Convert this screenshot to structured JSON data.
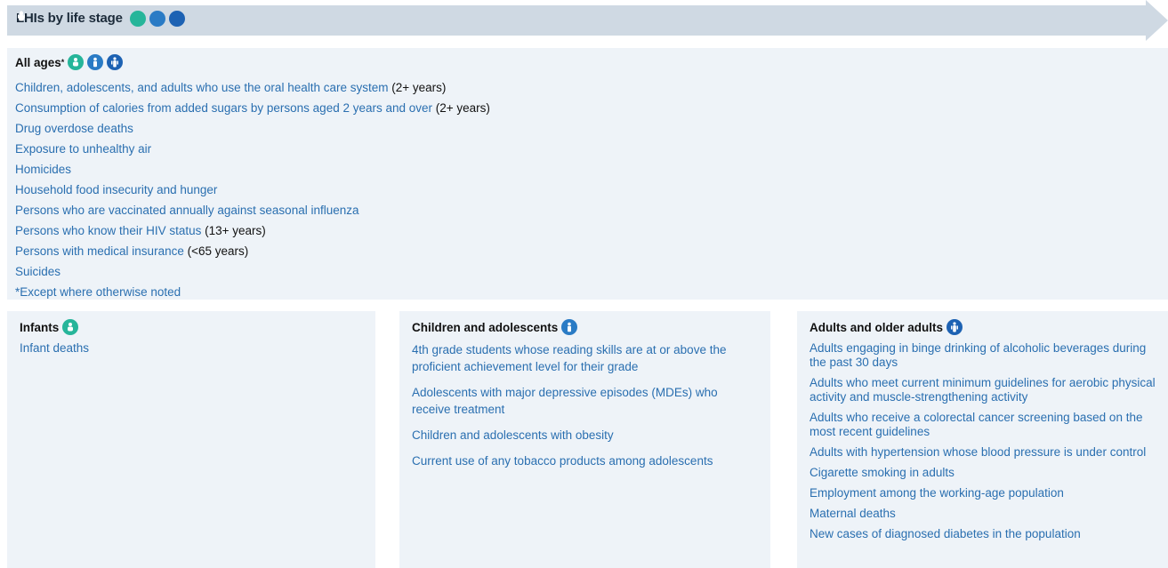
{
  "banner": {
    "title": "LHIs by life stage"
  },
  "icons": {
    "infant": "infant-icon",
    "child": "child-icon",
    "adult": "adult-icon"
  },
  "colors": {
    "banner": "#cfd9e3",
    "panel": "#eef3f8",
    "link": "#2a6fb0",
    "infant_icon": "#26b59a",
    "child_icon": "#2a7bc5",
    "adult_icon": "#1d62b3"
  },
  "all_ages": {
    "title": "All ages",
    "title_marker": "*",
    "items": [
      {
        "text": "Children, adolescents, and adults who use the oral health care system",
        "suffix": " (2+ years)"
      },
      {
        "text": "Consumption of calories from added sugars by persons aged 2 years and over",
        "suffix": " (2+ years)"
      },
      {
        "text": "Drug overdose deaths",
        "suffix": ""
      },
      {
        "text": "Exposure to unhealthy air",
        "suffix": ""
      },
      {
        "text": "Homicides",
        "suffix": ""
      },
      {
        "text": "Household food insecurity and hunger",
        "suffix": ""
      },
      {
        "text": "Persons who are vaccinated annually against seasonal influenza",
        "suffix": ""
      },
      {
        "text": "Persons who know their HIV status",
        "suffix": " (13+ years)"
      },
      {
        "text": "Persons with medical insurance",
        "suffix": " (<65 years)"
      },
      {
        "text": "Suicides",
        "suffix": ""
      }
    ],
    "note": "*Except where otherwise noted"
  },
  "infants": {
    "title": "Infants",
    "items": [
      "Infant deaths"
    ]
  },
  "children": {
    "title": "Children and adolescents",
    "items": [
      "4th grade students whose reading skills are at or above the proficient achievement level for their grade",
      "Adolescents with major depressive episodes (MDEs) who receive treatment",
      "Children and adolescents with obesity",
      "Current use of any tobacco products among adolescents"
    ]
  },
  "adults": {
    "title": "Adults and older adults",
    "items": [
      "Adults engaging in binge drinking of alcoholic beverages during the past 30 days",
      "Adults who meet current minimum guidelines for aerobic physical activity and muscle-strengthening activity",
      "Adults who receive a colorectal cancer screening based on the most recent guidelines",
      "Adults with hypertension whose blood pressure is under control",
      "Cigarette smoking in adults",
      "Employment among the working-age population",
      "Maternal deaths",
      "New cases of diagnosed diabetes in the population"
    ]
  }
}
